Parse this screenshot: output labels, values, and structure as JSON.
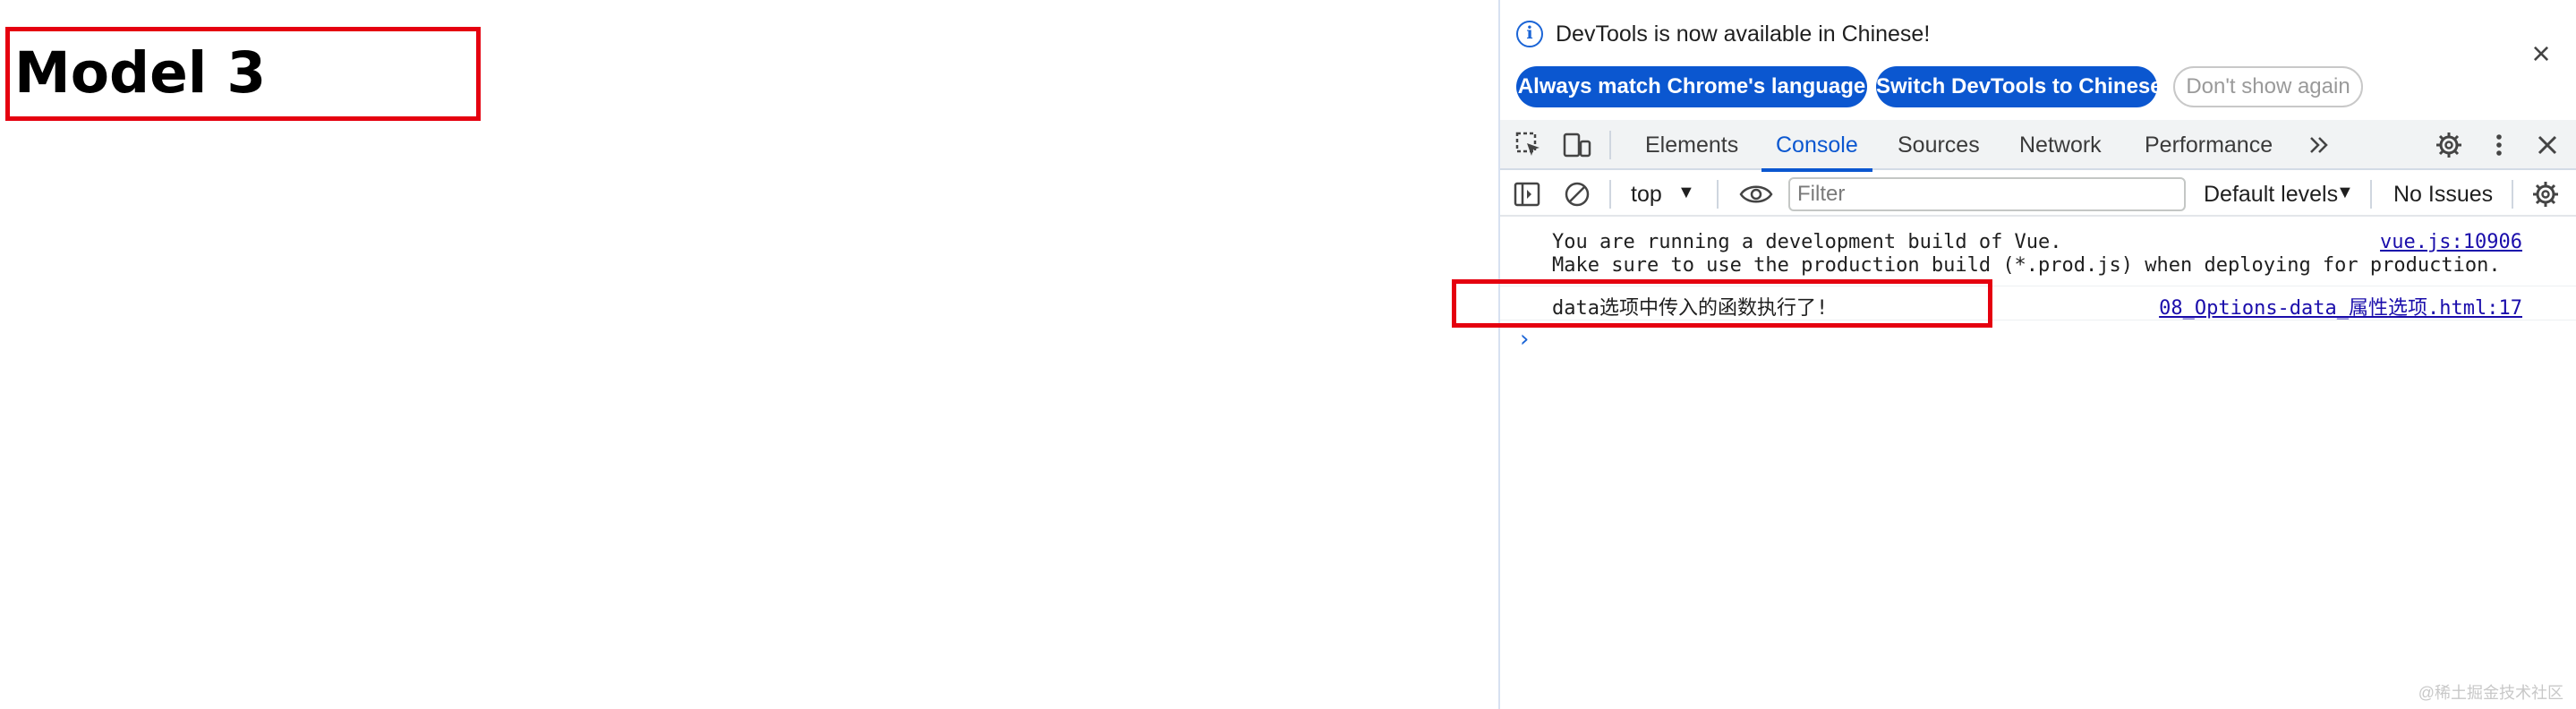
{
  "page": {
    "heading": "Model 3"
  },
  "devtools": {
    "infobar": {
      "message": "DevTools is now available in Chinese!",
      "icon": "info-icon",
      "buttons": {
        "match_language": "Always match Chrome's language",
        "switch_language": "Switch DevTools to Chinese",
        "dont_show": "Don't show again"
      },
      "close_icon": "close-icon"
    },
    "tabs": {
      "elements": "Elements",
      "console": "Console",
      "sources": "Sources",
      "network": "Network",
      "performance": "Performance",
      "active": "Console"
    },
    "toolbar": {
      "context": "top",
      "filter_placeholder": "Filter",
      "levels": "Default levels",
      "issues": "No Issues"
    },
    "console": {
      "messages": [
        {
          "lines": [
            "You are running a development build of Vue.",
            "Make sure to use the production build (*.prod.js) when deploying for production."
          ],
          "source": "vue.js:10906"
        },
        {
          "lines": [
            "data选项中传入的函数执行了!"
          ],
          "source": "08_Options-data_属性选项.html:17"
        }
      ]
    }
  },
  "colors": {
    "accent": "#0b57d0",
    "highlight": "#e5000f"
  },
  "watermark": "@稀土掘金技术社区"
}
